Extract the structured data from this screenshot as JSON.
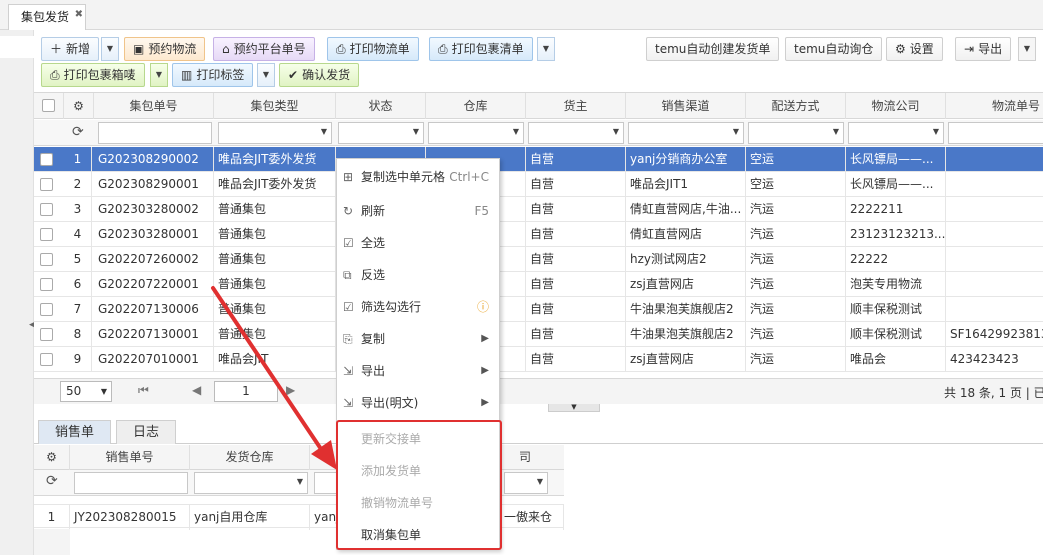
{
  "tab": {
    "title": "集包发货"
  },
  "toolbar": {
    "new": "新增",
    "reserve_logistics": "预约物流",
    "reserve_platform": "预约平台单号",
    "print_logistics": "打印物流单",
    "print_package_list": "打印包裹清单",
    "temu_create": "temu自动创建发货单",
    "temu_query": "temu自动询仓",
    "settings": "设置",
    "export": "导出",
    "print_box_label": "打印包裹箱唛",
    "print_label": "打印标签",
    "confirm_ship": "确认发货"
  },
  "grid": {
    "headers": [
      "集包单号",
      "集包类型",
      "状态",
      "仓库",
      "货主",
      "销售渠道",
      "配送方式",
      "物流公司",
      "物流单号"
    ],
    "rows": [
      {
        "n": "1",
        "id": "G202308290002",
        "type": "唯品会JIT委外发货",
        "status": "",
        "wh": "",
        "owner": "自营",
        "channel": "yanj分销商办公室",
        "ship": "空运",
        "carrier": "长风镖局——...",
        "tracking": "",
        "active": true
      },
      {
        "n": "2",
        "id": "G202308290001",
        "type": "唯品会JIT委外发货",
        "status": "",
        "wh": "",
        "owner": "自营",
        "channel": "唯品会JIT1",
        "ship": "空运",
        "carrier": "长风镖局——...",
        "tracking": ""
      },
      {
        "n": "3",
        "id": "G202303280002",
        "type": "普通集包",
        "status": "",
        "wh": "货...",
        "owner": "自营",
        "channel": "倩虹直营网店,牛油...",
        "ship": "汽运",
        "carrier": "2222211",
        "tracking": ""
      },
      {
        "n": "4",
        "id": "G202303280001",
        "type": "普通集包",
        "status": "",
        "wh": "货...",
        "owner": "自营",
        "channel": "倩虹直营网店",
        "ship": "汽运",
        "carrier": "23123123213...",
        "tracking": ""
      },
      {
        "n": "5",
        "id": "G202207260002",
        "type": "普通集包",
        "status": "",
        "wh": "",
        "owner": "自营",
        "channel": "hzy测试网店2",
        "ship": "汽运",
        "carrier": "22222",
        "tracking": ""
      },
      {
        "n": "6",
        "id": "G202207220001",
        "type": "普通集包",
        "status": "",
        "wh": "",
        "owner": "自营",
        "channel": "zsj直营网店",
        "ship": "汽运",
        "carrier": "泡芙专用物流",
        "tracking": ""
      },
      {
        "n": "7",
        "id": "G202207130006",
        "type": "普通集包",
        "status": "",
        "wh": "",
        "owner": "自营",
        "channel": "牛油果泡芙旗舰店2",
        "ship": "汽运",
        "carrier": "顺丰保税测试",
        "tracking": ""
      },
      {
        "n": "8",
        "id": "G202207130001",
        "type": "普通集包",
        "status": "",
        "wh": "",
        "owner": "自营",
        "channel": "牛油果泡芙旗舰店2",
        "ship": "汽运",
        "carrier": "顺丰保税测试",
        "tracking": "SF164299238130"
      },
      {
        "n": "9",
        "id": "G202207010001",
        "type": "唯品会JIT",
        "status": "",
        "wh": "",
        "owner": "自营",
        "channel": "zsj直营网店",
        "ship": "汽运",
        "carrier": "唯品会",
        "tracking": "423423423"
      }
    ]
  },
  "pager": {
    "size": "50",
    "page": "1",
    "summary": "共 18 条, 1 页 | 已"
  },
  "bottom_tabs": [
    "销售单",
    "日志"
  ],
  "sub_grid": {
    "headers": [
      "销售单号",
      "发货仓库",
      "",
      "司"
    ],
    "row": {
      "n": "1",
      "order": "JY202308280015",
      "wh": "yanj自用仓库",
      "c3": "yanj",
      "c4": "一傲来仓"
    }
  },
  "context_menu": [
    {
      "label": "复制选中单元格",
      "shortcut": "Ctrl+C",
      "icon": "grid-icon"
    },
    {
      "label": "刷新",
      "shortcut": "F5",
      "icon": "refresh-icon"
    },
    {
      "label": "全选",
      "icon": "check-all-icon"
    },
    {
      "label": "反选",
      "icon": "invert-icon"
    },
    {
      "label": "筛选勾选行",
      "icon": "filter-icon"
    },
    {
      "label": "复制",
      "icon": "copy-icon"
    },
    {
      "label": "导出",
      "icon": "export-icon"
    },
    {
      "label": "导出(明文)",
      "icon": "export-icon"
    },
    {
      "label": "更新交接单",
      "disabled": true
    },
    {
      "label": "添加发货单",
      "disabled": true
    },
    {
      "label": "撤销物流单号",
      "disabled": true
    },
    {
      "label": "取消集包单"
    }
  ],
  "colors": {
    "accent": "#4a78c8",
    "highlight": "#e03030"
  }
}
